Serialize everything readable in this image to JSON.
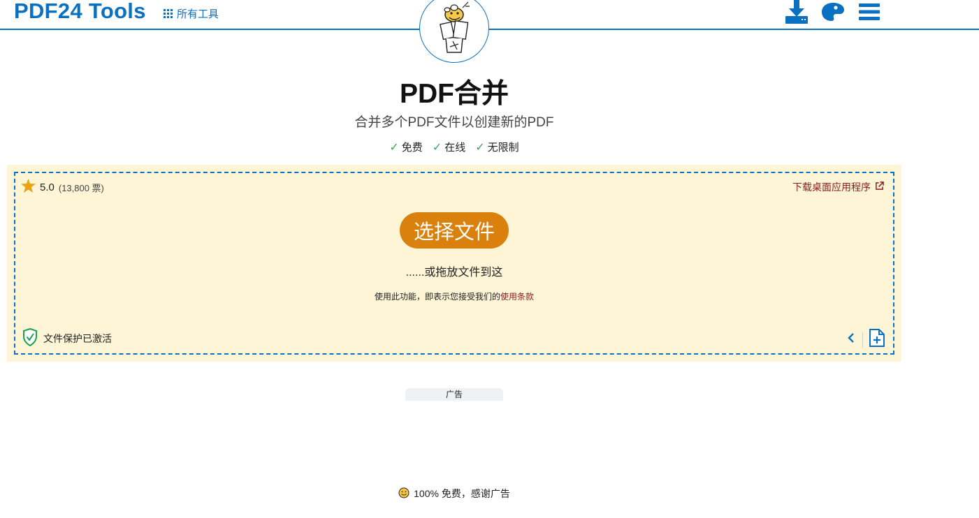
{
  "header": {
    "brand": "PDF24 Tools",
    "all_tools_label": "所有工具",
    "icons": [
      "download-icon",
      "palette-icon",
      "menu-icon"
    ]
  },
  "main": {
    "title": "PDF合并",
    "subtitle": "合并多个PDF文件以创建新的PDF",
    "features": [
      "免费",
      "在线",
      "无限制"
    ]
  },
  "dropzone": {
    "rating_value": "5.0",
    "rating_votes": "(13,800 票)",
    "desktop_link": "下载桌面应用程序",
    "choose_button": "选择文件",
    "drop_hint": "......或拖放文件到这",
    "terms_prefix": "使用此功能，即表示您接受我们的",
    "terms_link": "使用条款",
    "protection_label": "文件保护已激活"
  },
  "ad": {
    "label": "广告",
    "footer_note": "100% 免费，感谢广告"
  },
  "colors": {
    "brand_blue": "#0a70c2",
    "accent_orange": "#d9800d",
    "drop_bg": "#fdf5d6",
    "link_red": "#8a1c1c",
    "check_green": "#3aa657",
    "star_gold": "#e8a317"
  }
}
